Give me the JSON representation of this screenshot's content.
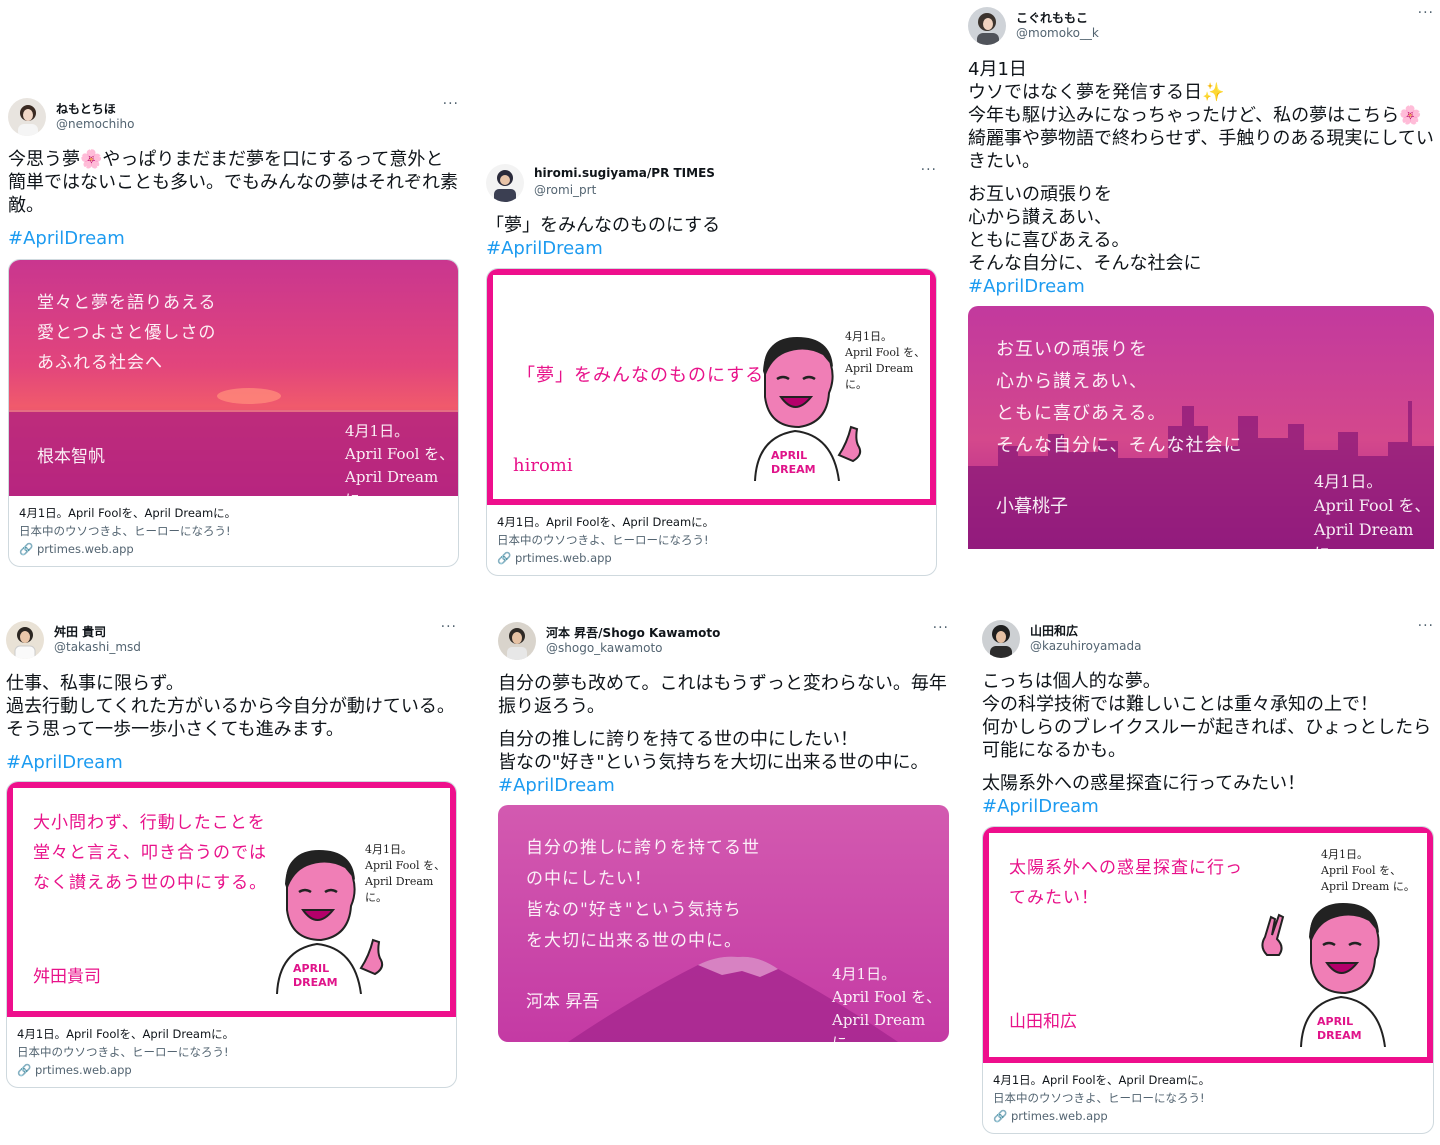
{
  "common": {
    "more_label": "···",
    "card_title": "4月1日。April Foolを、April Dreamに。",
    "card_desc": "日本中のウソつきよ、ヒーローになろう!",
    "card_domain": "🔗 prtimes.web.app",
    "hashtag": "#AprilDream",
    "img_date": "4月1日。\nApril Fool を、\nApril Dream に。"
  },
  "tweets": [
    {
      "name": "ねもとちほ",
      "handle": "@nemochiho",
      "text": "今思う夢🌸やっぱりまだまだ夢を口にするって意外と簡単ではないことも多い。でもみんなの夢はそれぞれ素敵。",
      "img_text": "堂々と夢を語りあえる\n愛とつよさと優しさの\nあふれる社会へ",
      "img_signature": "根本智帆"
    },
    {
      "name": "hiromi.sugiyama/PR TIMES",
      "handle": "@romi_prt",
      "text": "「夢」をみんなのものにする",
      "img_text": "「夢」をみんなのものにする",
      "img_signature": "hiromi"
    },
    {
      "name": "こぐれももこ",
      "handle": "@momoko__k",
      "text": "4月1日\nウソではなく夢を発信する日✨\n今年も駆け込みになっちゃったけど、私の夢はこちら🌸\n綺麗事や夢物語で終わらせず、手触りのある現実にしていきたい。",
      "text2": "お互いの頑張りを\n心から讃えあい、\nともに喜びあえる。\nそんな自分に、そんな社会に",
      "img_text": "お互いの頑張りを\n心から讃えあい、\nともに喜びあえる。\nそんな自分に、そんな社会に",
      "img_signature": "小暮桃子"
    },
    {
      "name": "舛田 貴司",
      "handle": "@takashi_msd",
      "text": "仕事、私事に限らず。\n過去行動してくれた方がいるから今自分が動けている。\nそう思って一歩一歩小さくても進みます。",
      "img_text": "大小問わず、行動したことを\n堂々と言え、叩き合うのでは\nなく讃えあう世の中にする。",
      "img_signature": "舛田貴司"
    },
    {
      "name": "河本 昇吾/Shogo Kawamoto",
      "handle": "@shogo_kawamoto",
      "text": "自分の夢も改めて。これはもうずっと変わらない。毎年振り返ろう。",
      "text2": "自分の推しに誇りを持てる世の中にしたい！\n皆なの\"好き\"という気持ちを大切に出来る世の中に。",
      "img_text": "自分の推しに誇りを持てる世\nの中にしたい！\n皆なの\"好き\"という気持ち\nを大切に出来る世の中に。",
      "img_signature": "河本 昇吾"
    },
    {
      "name": "山田和広",
      "handle": "@kazuhiroyamada",
      "text": "こっちは個人的な夢。\n今の科学技術では難しいことは重々承知の上で！\n何かしらのブレイクスルーが起きれば、ひょっとしたら可能になるかも。",
      "text2": "太陽系外への惑星探査に行ってみたい！",
      "img_text": "太陽系外への惑星探査に行っ\nてみたい！",
      "img_signature": "山田和広"
    }
  ],
  "colors": {
    "accent_pink": "#ee0f8c",
    "link_blue": "#1d9bf0"
  }
}
